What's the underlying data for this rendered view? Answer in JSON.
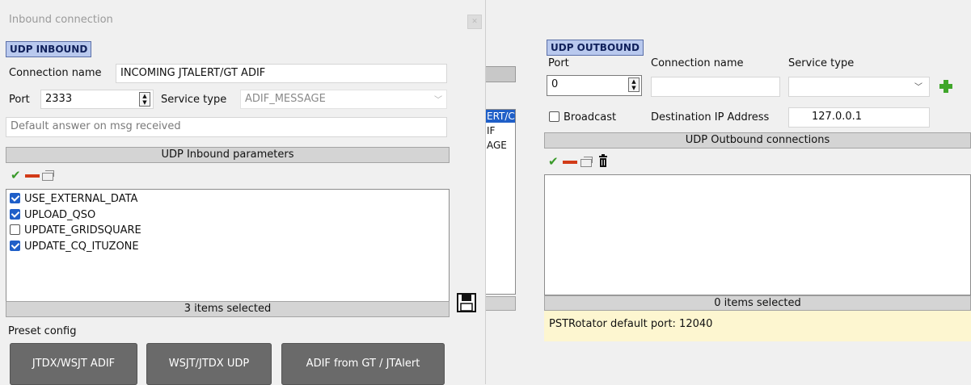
{
  "window": {
    "title": "Inbound connection"
  },
  "inbound": {
    "section_label": "UDP INBOUND",
    "connection_name_label": "Connection name",
    "connection_name_value": "INCOMING JTALERT/GT ADIF",
    "port_label": "Port",
    "port_value": "2333",
    "service_type_label": "Service type",
    "service_type_value": "ADIF_MESSAGE",
    "default_answer_placeholder": "Default answer on msg received",
    "params_header": "UDP Inbound parameters",
    "params": [
      {
        "label": "USE_EXTERNAL_DATA",
        "checked": true
      },
      {
        "label": "UPLOAD_QSO",
        "checked": true
      },
      {
        "label": "UPDATE_GRIDSQUARE",
        "checked": false
      },
      {
        "label": "UPDATE_CQ_ITUZONE",
        "checked": true
      }
    ],
    "status": "3 items selected",
    "preset_label": "Preset config",
    "presets": [
      "JTDX/WSJT ADIF",
      "WSJT/JTDX UDP",
      "ADIF from GT / JTAlert"
    ]
  },
  "behind": {
    "fragments": [
      "ERT/C",
      "IF",
      "AGE"
    ]
  },
  "outbound": {
    "section_label": "UDP OUTBOUND",
    "port_label": "Port",
    "connection_name_label": "Connection name",
    "service_type_label": "Service type",
    "port_value": "0",
    "broadcast_label": "Broadcast",
    "dest_ip_label": "Destination IP Address",
    "dest_ip_value": "127.0.0.1",
    "connections_header": "UDP Outbound connections",
    "status": "0 items selected",
    "hint": "PSTRotator default port: 12040"
  },
  "colors": {
    "accent": "#1f5fc8",
    "hint_bg": "#fdf6d0",
    "section_tag": "#b9c9ee",
    "preset_bg": "#6a6a6a"
  }
}
